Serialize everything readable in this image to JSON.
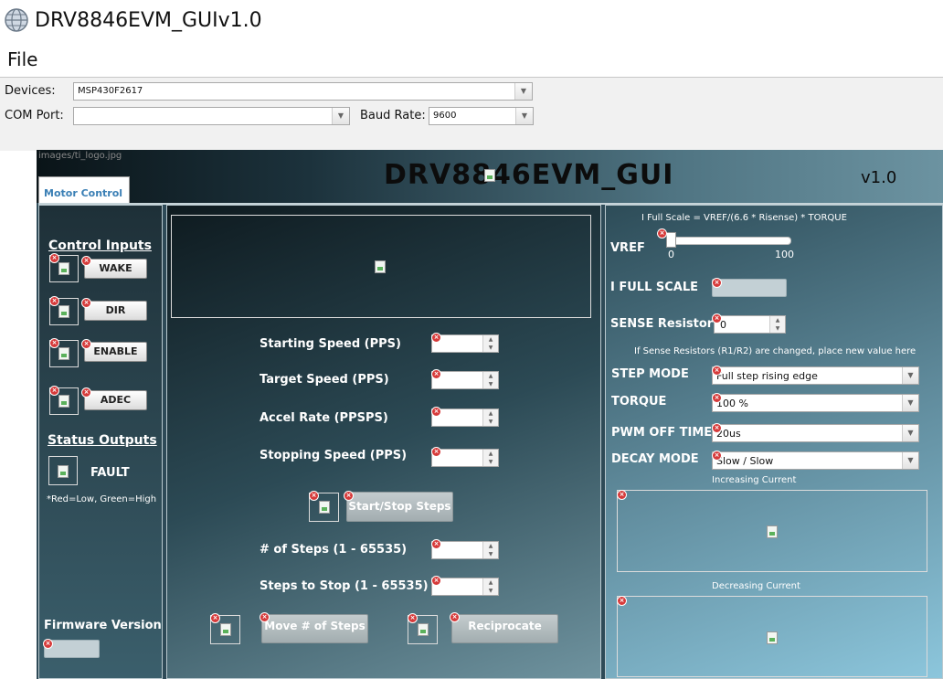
{
  "window": {
    "title": "DRV8846EVM_GUIv1.0"
  },
  "menu": {
    "file": "File"
  },
  "toolbar": {
    "devices_label": "Devices:",
    "devices_value": "MSP430F2617",
    "com_label": "COM Port:",
    "com_value": "",
    "baud_label": "Baud Rate:",
    "baud_value": "9600"
  },
  "header": {
    "logo_alt": "images/ti_logo.jpg",
    "title": "DRV8846EVM_GUI",
    "version": "v1.0"
  },
  "tabs": [
    {
      "label": "Motor Control"
    }
  ],
  "left": {
    "control_inputs": "Control Inputs",
    "wake": "WAKE",
    "dir": "DIR",
    "enable": "ENABLE",
    "adec": "ADEC",
    "status_outputs": "Status Outputs",
    "fault": "FAULT",
    "legend": "*Red=Low, Green=High",
    "firmware_label": "Firmware Version",
    "firmware_value": ""
  },
  "middle": {
    "starting_speed": "Starting Speed (PPS)",
    "target_speed": "Target Speed (PPS)",
    "accel_rate": "Accel Rate (PPSPS)",
    "stopping_speed": "Stopping Speed (PPS)",
    "start_stop": "Start/Stop Steps",
    "num_steps": "# of Steps (1 - 65535)",
    "steps_to_stop": "Steps to Stop (1 - 65535)",
    "move_steps": "Move # of Steps",
    "reciprocate": "Reciprocate"
  },
  "right": {
    "formula": "I Full Scale = VREF/(6.6 * Risense) * TORQUE",
    "vref_label": "VREF",
    "vref_min": "0",
    "vref_max": "100",
    "vref_level": 0,
    "ifs_label": "I FULL SCALE",
    "sense_label": "SENSE Resistor",
    "sense_value": "0",
    "sense_note": "If Sense Resistors (R1/R2) are changed, place new value here",
    "step_mode_label": "STEP MODE",
    "step_mode_value": "Full step rising edge",
    "torque_label": "TORQUE",
    "torque_value": "100 %",
    "pwm_label": "PWM OFF TIME",
    "pwm_value": "20us",
    "decay_label": "DECAY MODE",
    "decay_value": "Slow / Slow",
    "increasing": "Increasing Current",
    "decreasing": "Decreasing Current"
  },
  "icons": {
    "app": "globe-icon",
    "dropdown": "chevron-down-icon",
    "error": "error-x-icon",
    "broken_image": "broken-image-icon"
  }
}
